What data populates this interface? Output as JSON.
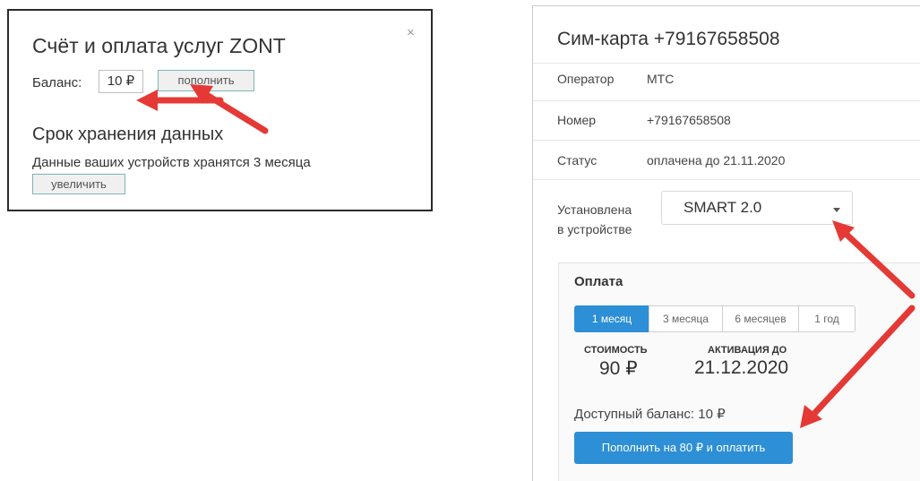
{
  "billing_dialog": {
    "title": "Счёт и оплата услуг ZONT",
    "close_glyph": "×",
    "balance_label": "Баланс:",
    "balance_value": "10 ₽",
    "topup_button": "пополнить",
    "storage_title": "Срок хранения данных",
    "storage_text": "Данные ваших устройств хранятся 3 месяца",
    "increase_button": "увеличить"
  },
  "sim_panel": {
    "title": "Сим-карта +79167658508",
    "rows": [
      {
        "label": "Оператор",
        "value": "МТС"
      },
      {
        "label": "Номер",
        "value": "+79167658508"
      },
      {
        "label": "Статус",
        "value": "оплачена до 21.11.2020"
      }
    ],
    "device_label_line1": "Установлена",
    "device_label_line2": "в устройстве",
    "device_select_value": "SMART 2.0",
    "payment": {
      "title": "Оплата",
      "tabs": [
        {
          "label": "1 месяц",
          "active": true
        },
        {
          "label": "3 месяца",
          "active": false
        },
        {
          "label": "6 месяцев",
          "active": false
        },
        {
          "label": "1 год",
          "active": false
        }
      ],
      "cost_label": "СТОИМОСТЬ",
      "cost_value": "90 ₽",
      "activation_label": "АКТИВАЦИЯ ДО",
      "activation_value": "21.12.2020",
      "available_balance": "Доступный баланс: 10 ₽",
      "pay_button": "Пополнить на 80 ₽ и оплатить"
    }
  },
  "colors": {
    "accent_blue": "#2d8fd6",
    "arrow_red": "#e53935"
  }
}
